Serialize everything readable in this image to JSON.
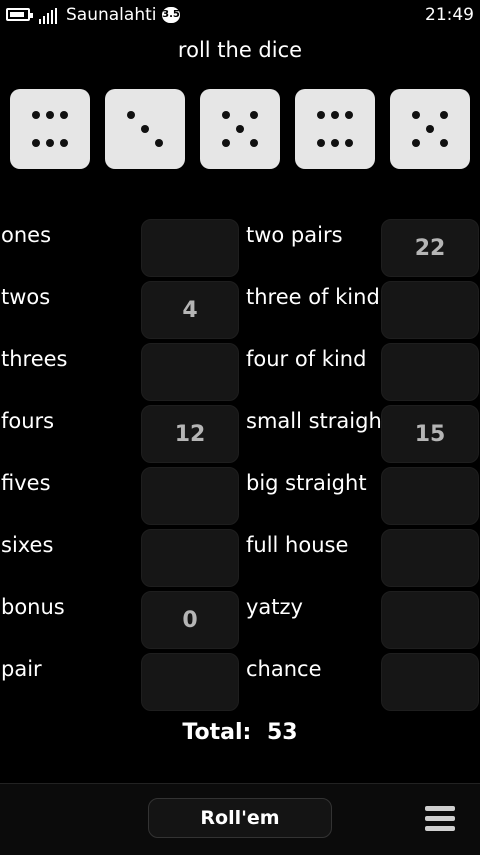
{
  "status": {
    "operator": "Saunalahti",
    "network_badge": "3.5",
    "time": "21:49"
  },
  "title": "roll the dice",
  "dice": [
    6,
    3,
    5,
    6,
    5
  ],
  "left_column": [
    {
      "label": "ones",
      "score": ""
    },
    {
      "label": "twos",
      "score": "4"
    },
    {
      "label": "threes",
      "score": ""
    },
    {
      "label": "fours",
      "score": "12"
    },
    {
      "label": "fives",
      "score": ""
    },
    {
      "label": "sixes",
      "score": ""
    },
    {
      "label": "bonus",
      "score": "0"
    },
    {
      "label": "pair",
      "score": ""
    }
  ],
  "right_column": [
    {
      "label": "two pairs",
      "score": "22"
    },
    {
      "label": "three of kind",
      "score": ""
    },
    {
      "label": "four of kind",
      "score": ""
    },
    {
      "label": "small straight",
      "score": "15"
    },
    {
      "label": "big straight",
      "score": ""
    },
    {
      "label": "full house",
      "score": ""
    },
    {
      "label": "yatzy",
      "score": ""
    },
    {
      "label": "chance",
      "score": ""
    }
  ],
  "total": {
    "label": "Total:",
    "value": "53"
  },
  "toolbar": {
    "roll_label": "Roll'em",
    "menu_icon": "menu-icon"
  }
}
